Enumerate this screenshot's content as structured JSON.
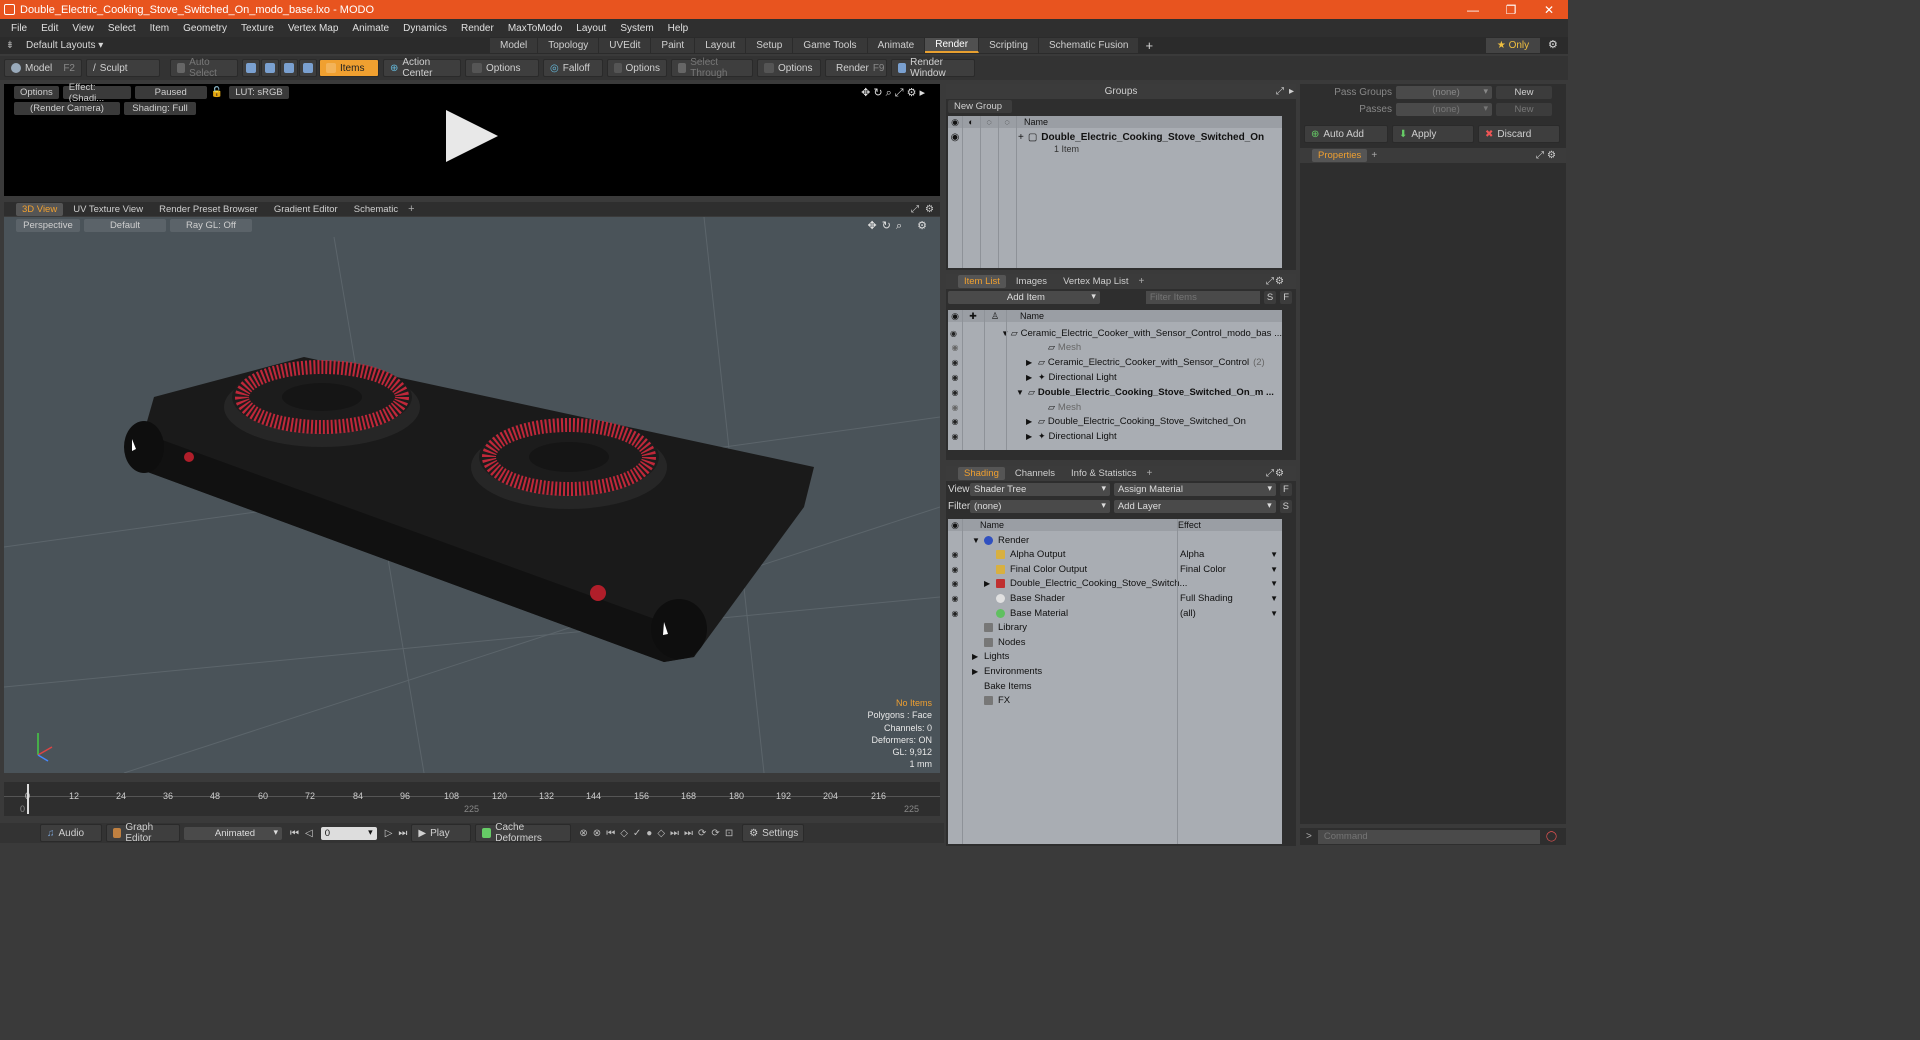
{
  "window": {
    "title": "Double_Electric_Cooking_Stove_Switched_On_modo_base.lxo - MODO",
    "controls": [
      "—",
      "❐",
      "✕"
    ]
  },
  "menu": [
    "File",
    "Edit",
    "View",
    "Select",
    "Item",
    "Geometry",
    "Texture",
    "Vertex Map",
    "Animate",
    "Dynamics",
    "Render",
    "MaxToModo",
    "Layout",
    "System",
    "Help"
  ],
  "layout": {
    "preset": "Default Layouts ▾",
    "tabs": [
      "Model",
      "Topology",
      "UVEdit",
      "Paint",
      "Layout",
      "Setup",
      "Game Tools",
      "Animate",
      "Render",
      "Scripting",
      "Schematic Fusion"
    ],
    "active_tab": "Render",
    "add": "+",
    "only": "★ Only"
  },
  "toolbar": {
    "model": "Model",
    "model_key": "F2",
    "sculpt": "Sculpt",
    "auto_select": "Auto Select",
    "items": "Items",
    "action_center": "Action Center",
    "options": "Options",
    "falloff": "Falloff",
    "select_through": "Select Through",
    "render": "Render",
    "render_key": "F9",
    "render_window": "Render Window"
  },
  "preview": {
    "options": "Options",
    "effect": "Effect: (Shadi...",
    "paused": "Paused",
    "lut": "LUT: sRGB",
    "camera": "(Render Camera)",
    "shading": "Shading: Full"
  },
  "viewport": {
    "tabs": [
      "3D View",
      "UV Texture View",
      "Render Preset Browser",
      "Gradient Editor",
      "Schematic"
    ],
    "active": "3D View",
    "perspective": "Perspective",
    "default": "Default",
    "raygl": "Ray GL: Off",
    "stats": {
      "no_items": "No Items",
      "polygons": "Polygons : Face",
      "channels": "Channels: 0",
      "deformers": "Deformers: ON",
      "gl": "GL: 9,912",
      "unit": "1 mm"
    }
  },
  "timeline": {
    "ticks": [
      "0",
      "12",
      "24",
      "36",
      "48",
      "60",
      "72",
      "84",
      "96",
      "108",
      "120",
      "132",
      "144",
      "156",
      "168",
      "180",
      "192",
      "204",
      "216"
    ],
    "start": "0",
    "end": "225",
    "mid": "225"
  },
  "bottombar": {
    "audio": "Audio",
    "graph_editor": "Graph Editor",
    "animated": "Animated",
    "frame": "0",
    "play": "Play",
    "cache": "Cache Deformers",
    "settings": "Settings"
  },
  "groups": {
    "title": "Groups",
    "new_group": "New Group",
    "col_name": "Name",
    "item_name": "Double_Electric_Cooking_Stove_Switched_On",
    "item_count": "1 Item"
  },
  "itemlist": {
    "tabs": [
      "Item List",
      "Images",
      "Vertex Map List"
    ],
    "add_item": "Add Item",
    "filter": "Filter Items",
    "col_name": "Name",
    "rows": [
      {
        "label": "Ceramic_Electric_Cooker_with_Sensor_Control_modo_bas ...",
        "indent": 0,
        "bold": false
      },
      {
        "label": "Mesh",
        "indent": 2,
        "bold": false,
        "dim": true
      },
      {
        "label": "Ceramic_Electric_Cooker_with_Sensor_Control",
        "extra": "(2)",
        "indent": 1,
        "bold": false
      },
      {
        "label": "Directional Light",
        "indent": 1,
        "bold": false
      },
      {
        "label": "Double_Electric_Cooking_Stove_Switched_On_m ...",
        "indent": 0,
        "bold": true
      },
      {
        "label": "Mesh",
        "indent": 2,
        "bold": false,
        "dim": true
      },
      {
        "label": "Double_Electric_Cooking_Stove_Switched_On",
        "indent": 1,
        "bold": false
      },
      {
        "label": "Directional Light",
        "indent": 1,
        "bold": false
      }
    ]
  },
  "shading": {
    "tabs": [
      "Shading",
      "Channels",
      "Info & Statistics"
    ],
    "view_label": "View",
    "view_value": "Shader Tree",
    "assign": "Assign Material",
    "filter_label": "Filter",
    "filter_value": "(none)",
    "add_layer": "Add Layer",
    "col_name": "Name",
    "col_effect": "Effect",
    "rows": [
      {
        "label": "Render",
        "effect": "",
        "indent": 0
      },
      {
        "label": "Alpha Output",
        "effect": "Alpha",
        "indent": 1
      },
      {
        "label": "Final Color Output",
        "effect": "Final Color",
        "indent": 1
      },
      {
        "label": "Double_Electric_Cooking_Stove_Switch...",
        "effect": "",
        "indent": 1
      },
      {
        "label": "Base Shader",
        "effect": "Full Shading",
        "indent": 1
      },
      {
        "label": "Base Material",
        "effect": "(all)",
        "indent": 1
      },
      {
        "label": "Library",
        "effect": "",
        "indent": 0
      },
      {
        "label": "Nodes",
        "effect": "",
        "indent": 0
      },
      {
        "label": "Lights",
        "effect": "",
        "indent": -1
      },
      {
        "label": "Environments",
        "effect": "",
        "indent": -1
      },
      {
        "label": "Bake Items",
        "effect": "",
        "indent": -1
      },
      {
        "label": "FX",
        "effect": "",
        "indent": -1
      }
    ]
  },
  "passes": {
    "pass_groups": "Pass Groups",
    "passes": "Passes",
    "none": "(none)",
    "new": "New",
    "auto_add": "Auto Add",
    "apply": "Apply",
    "discard": "Discard",
    "properties": "Properties"
  },
  "command": {
    "placeholder": "Command"
  },
  "colors": {
    "accent": "#f0a030",
    "title": "#e8541f",
    "burner": "#c0283a"
  }
}
